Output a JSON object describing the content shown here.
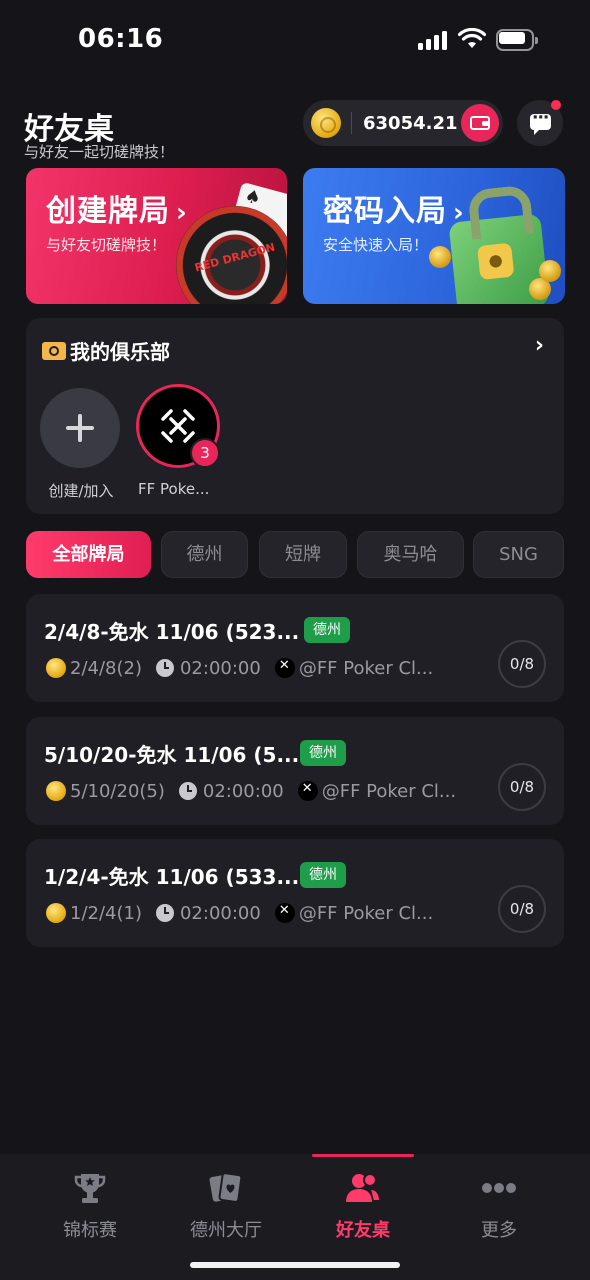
{
  "status_bar": {
    "time": "06:16"
  },
  "header": {
    "title": "好友桌",
    "subtitle": "与好友一起切磋牌技！",
    "balance": "63054.21"
  },
  "banners": {
    "create": {
      "title": "创建牌局",
      "subtitle": "与好友切磋牌技！",
      "art_text": "RED DRAGON"
    },
    "code": {
      "title": "密码入局",
      "subtitle": "安全快速入局！"
    }
  },
  "clubs": {
    "title": "我的俱乐部",
    "add_label": "创建/加入",
    "items": [
      {
        "name": "FF Poke...",
        "badge": "3"
      }
    ]
  },
  "filter_tabs": [
    {
      "label": "全部牌局",
      "active": true
    },
    {
      "label": "德州",
      "active": false
    },
    {
      "label": "短牌",
      "active": false
    },
    {
      "label": "奥马哈",
      "active": false
    },
    {
      "label": "SNG",
      "active": false
    }
  ],
  "games": [
    {
      "title": "2/4/8-免水 11/06 (523...",
      "tag": "德州",
      "stakes": "2/4/8(2)",
      "duration": "02:00:00",
      "club": "@FF Poker Cl...",
      "seats": "0/8"
    },
    {
      "title": "5/10/20-免水 11/06 (5...",
      "tag": "德州",
      "stakes": "5/10/20(5)",
      "duration": "02:00:00",
      "club": "@FF Poker Cl...",
      "seats": "0/8"
    },
    {
      "title": "1/2/4-免水 11/06 (533...",
      "tag": "德州",
      "stakes": "1/2/4(1)",
      "duration": "02:00:00",
      "club": "@FF Poker Cl...",
      "seats": "0/8"
    }
  ],
  "bottom_nav": [
    {
      "label": "锦标赛",
      "icon": "trophy-icon",
      "active": false
    },
    {
      "label": "德州大厅",
      "icon": "cards-icon",
      "active": false
    },
    {
      "label": "好友桌",
      "icon": "friends-icon",
      "active": true
    },
    {
      "label": "更多",
      "icon": "more-icon",
      "active": false
    }
  ],
  "colors": {
    "accent": "#e8265a",
    "tag_green": "#1f9d4a",
    "background": "#151519",
    "card": "#1f1f25"
  }
}
